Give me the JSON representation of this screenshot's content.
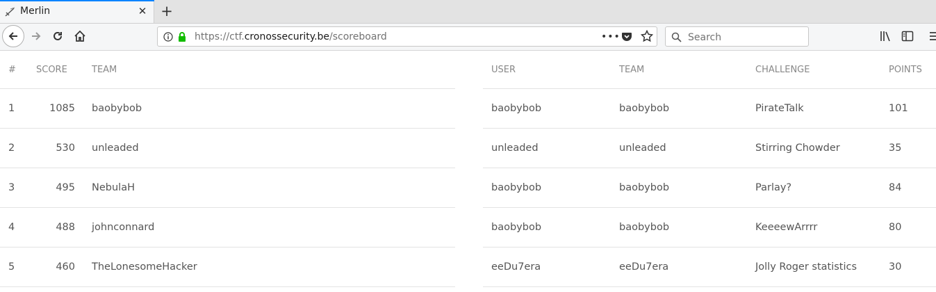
{
  "browser": {
    "tab_title": "Merlin",
    "new_tab_label": "+",
    "url_prefix": "https://ctf.",
    "url_host": "cronossecurity.be",
    "url_path": "/scoreboard",
    "search_placeholder": "Search",
    "more_label": "•••"
  },
  "scoreboard": {
    "headers": {
      "rank": "#",
      "score": "SCORE",
      "team": "TEAM"
    },
    "rows": [
      {
        "rank": "1",
        "score": "1085",
        "team": "baobybob"
      },
      {
        "rank": "2",
        "score": "530",
        "team": "unleaded"
      },
      {
        "rank": "3",
        "score": "495",
        "team": "NebulaH"
      },
      {
        "rank": "4",
        "score": "488",
        "team": "johnconnard"
      },
      {
        "rank": "5",
        "score": "460",
        "team": "TheLonesomeHacker"
      }
    ]
  },
  "solves": {
    "headers": {
      "user": "USER",
      "team": "TEAM",
      "challenge": "CHALLENGE",
      "points": "POINTS"
    },
    "rows": [
      {
        "user": "baobybob",
        "team": "baobybob",
        "challenge": "PirateTalk",
        "points": "101"
      },
      {
        "user": "unleaded",
        "team": "unleaded",
        "challenge": "Stirring Chowder",
        "points": "35"
      },
      {
        "user": "baobybob",
        "team": "baobybob",
        "challenge": "Parlay?",
        "points": "84"
      },
      {
        "user": "baobybob",
        "team": "baobybob",
        "challenge": "KeeeewArrrr",
        "points": "80"
      },
      {
        "user": "eeDu7era",
        "team": "eeDu7era",
        "challenge": "Jolly Roger statistics",
        "points": "30"
      }
    ]
  },
  "colors": {
    "tab_accent": "#0a84ff",
    "lock_green": "#12bc00"
  }
}
